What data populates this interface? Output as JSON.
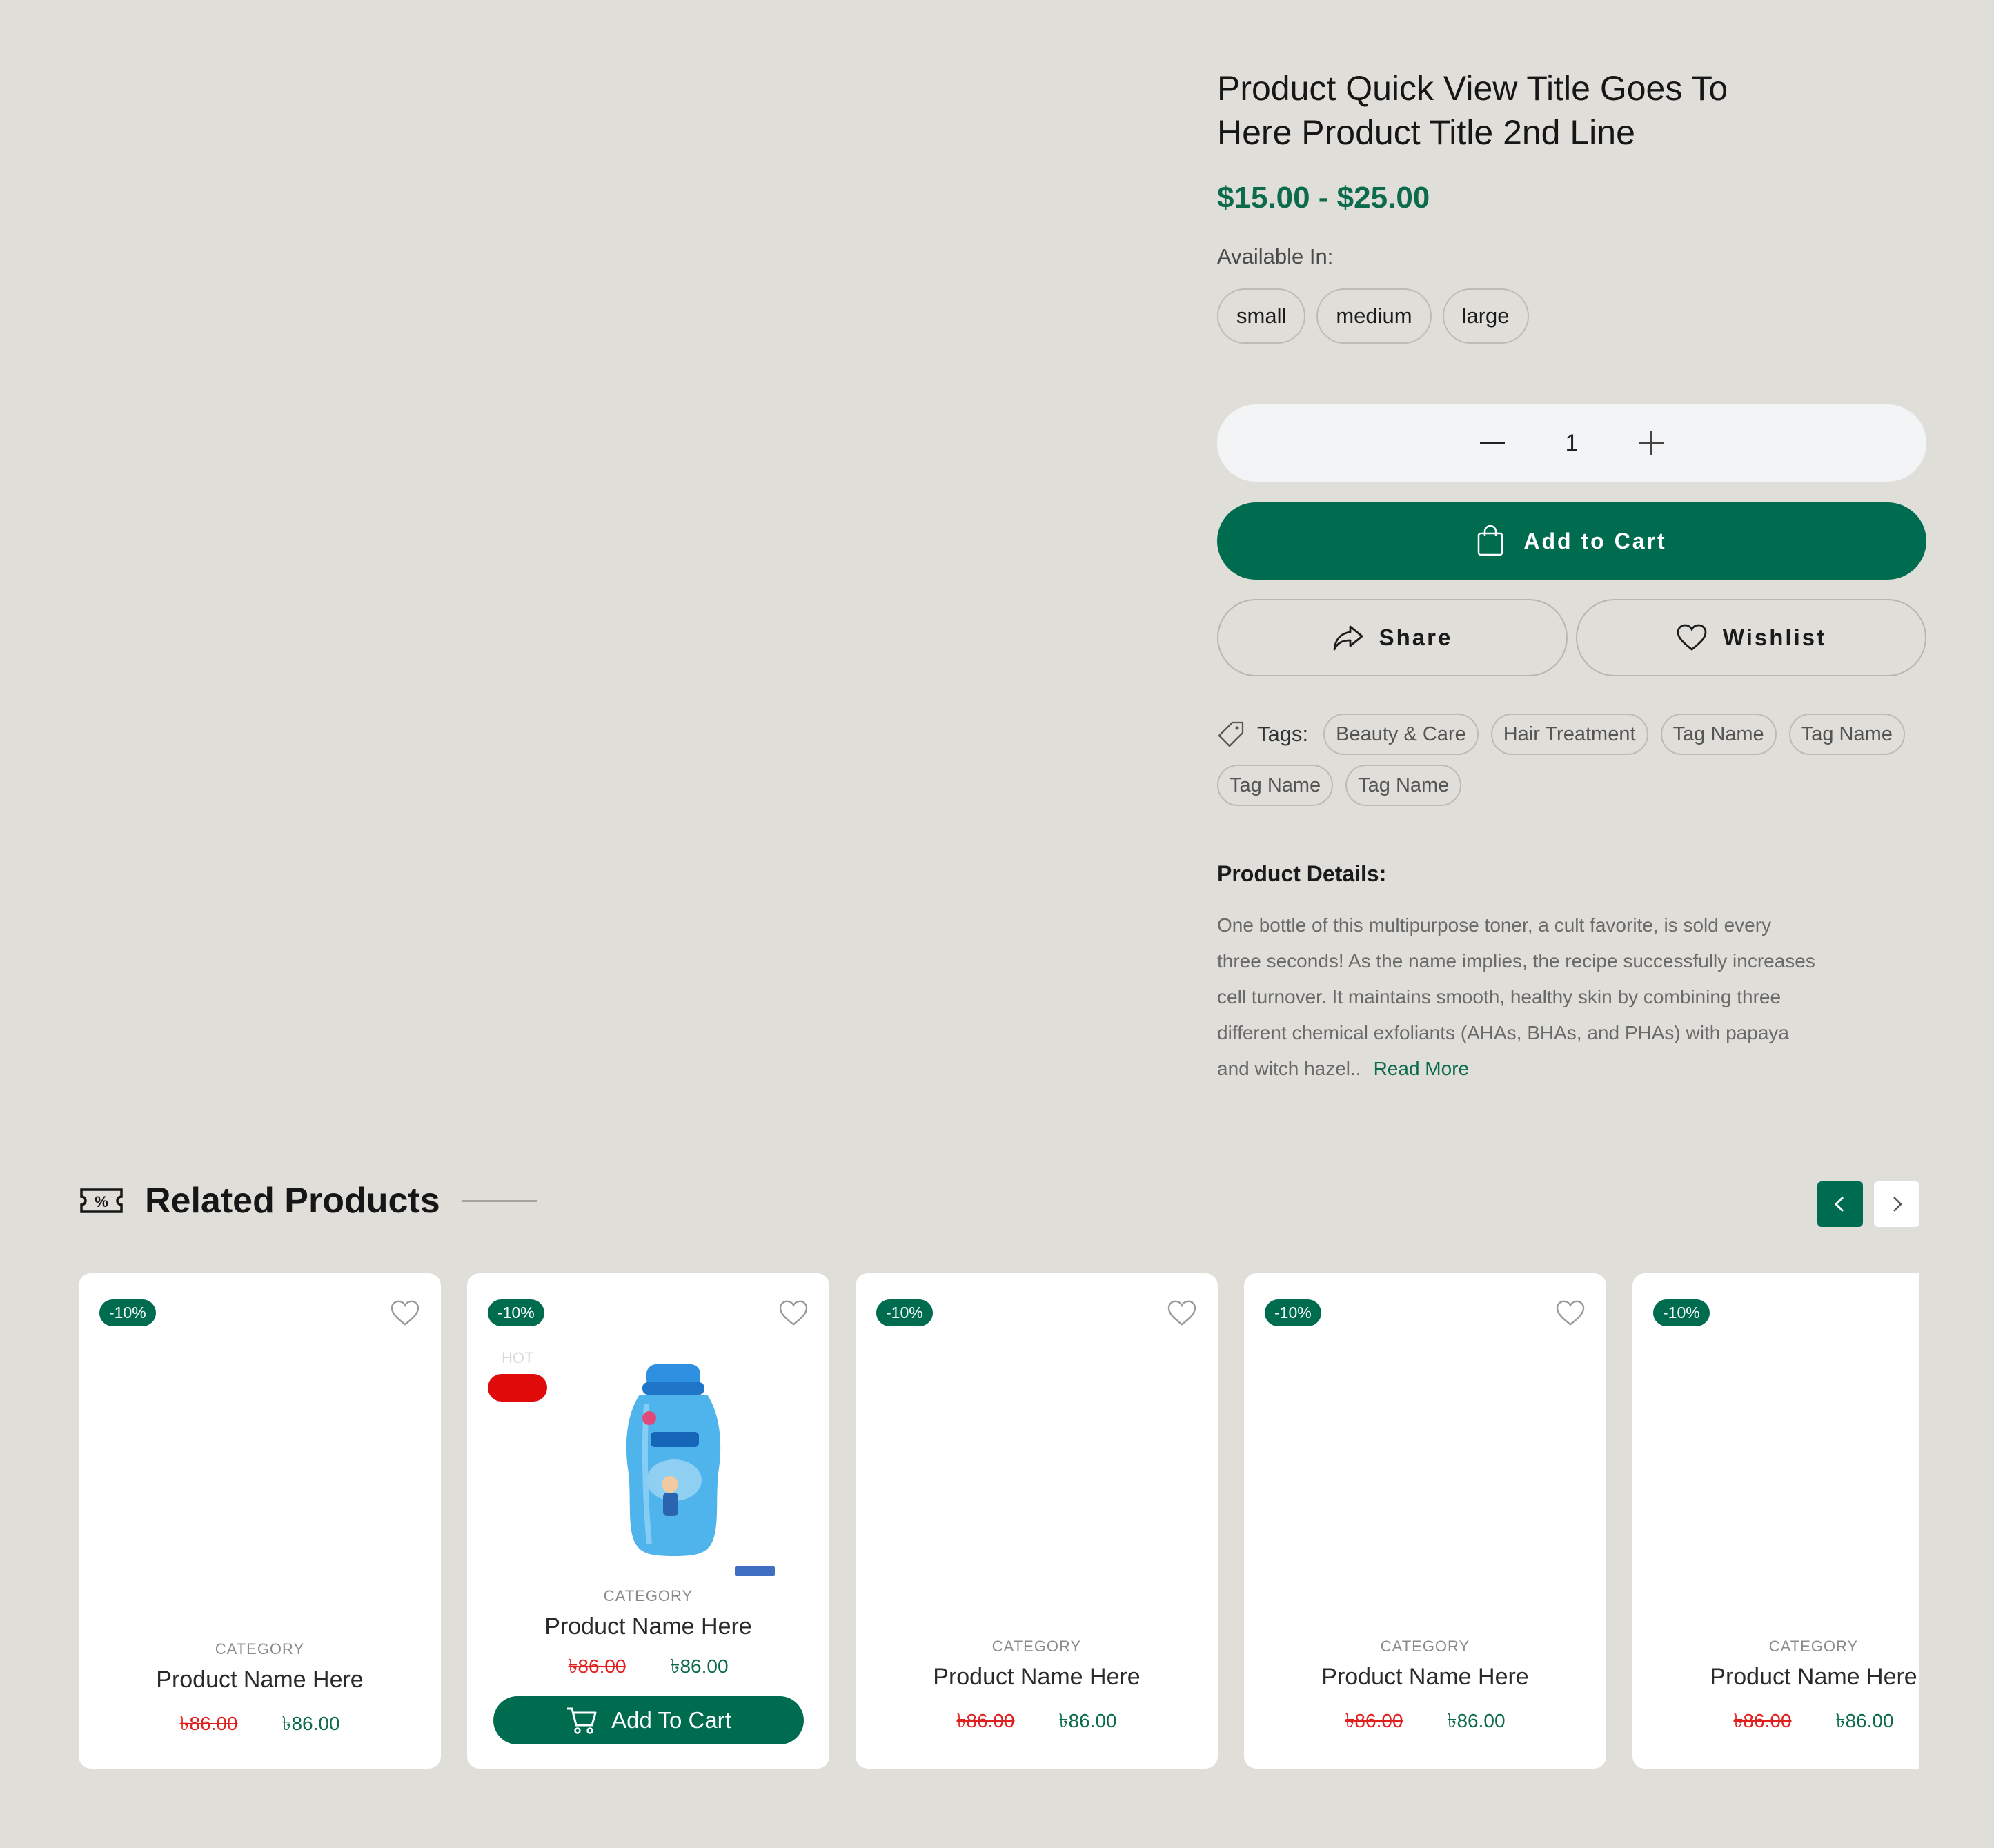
{
  "quick_view": {
    "title_line1": "Product Quick View  Title Goes To",
    "title_line2": "Here Product Title 2nd Line",
    "price": "$15.00 - $25.00",
    "available_label": "Available In:",
    "sizes": [
      "small",
      "medium",
      "large"
    ],
    "quantity": "1",
    "add_to_cart": "Add to Cart",
    "share": "Share",
    "wishlist": "Wishlist",
    "tags_label": "Tags:",
    "tags": [
      "Beauty & Care",
      "Hair Treatment",
      "Tag Name",
      "Tag Name",
      "Tag Name",
      "Tag Name"
    ],
    "details_heading": "Product Details:",
    "details_text": "One bottle of this multipurpose toner, a cult favorite, is sold every three seconds! As the name implies, the recipe successfully increases cell turnover. It maintains smooth, healthy skin by combining three different chemical exfoliants (AHAs, BHAs, and PHAs) with papaya and witch hazel..",
    "read_more": "Read More"
  },
  "related": {
    "title": "Related Products",
    "products": [
      {
        "badge": "-10%",
        "category": "CATEGORY",
        "name": "Product Name Here",
        "old_price": "৳86.00",
        "price": "৳86.00"
      },
      {
        "badge": "-10%",
        "category": "CATEGORY",
        "name": "Product Name Here",
        "old_price": "৳86.00",
        "price": "৳86.00",
        "hot": "HOT",
        "cart_label": "Add To Cart"
      },
      {
        "badge": "-10%",
        "category": "CATEGORY",
        "name": "Product Name Here",
        "old_price": "৳86.00",
        "price": "৳86.00"
      },
      {
        "badge": "-10%",
        "category": "CATEGORY",
        "name": "Product Name Here",
        "old_price": "৳86.00",
        "price": "৳86.00"
      },
      {
        "badge": "-10%",
        "category": "CATEGORY",
        "name": "Product Name Here",
        "old_price": "৳86.00",
        "price": "৳86.00"
      }
    ]
  },
  "colors": {
    "accent": "#006c4f",
    "background": "#e0ded8",
    "sale_red": "#e0201e"
  }
}
